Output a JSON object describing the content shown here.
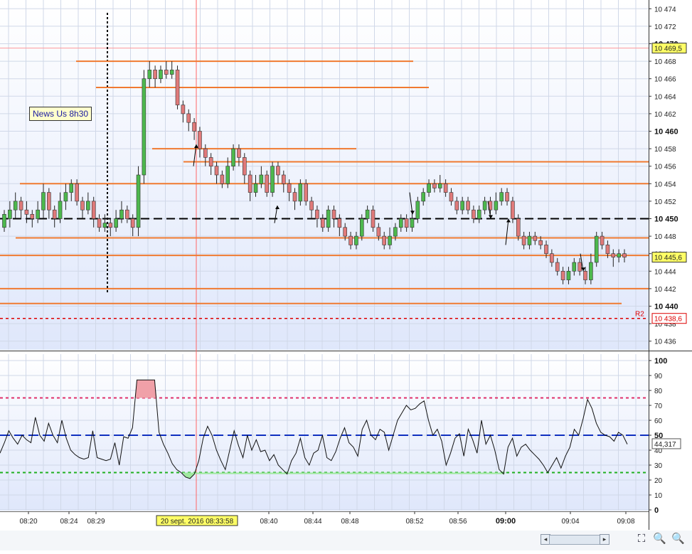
{
  "chart_data": [
    {
      "type": "candlestick",
      "title": "",
      "ylim": [
        10435,
        10475
      ],
      "y_ticks": [
        "10 436",
        "10 438",
        "10 440",
        "10 442",
        "10 444",
        "10 446",
        "10 448",
        "10 450",
        "10 452",
        "10 454",
        "10 456",
        "10 458",
        "10 460",
        "10 462",
        "10 464",
        "10 466",
        "10 468",
        "10 470",
        "10 472",
        "10 474"
      ],
      "x_ticks": [
        "08:20",
        "08:24",
        "08:29",
        "08:40",
        "08:44",
        "08:48",
        "08:52",
        "08:56",
        "09:00",
        "09:04",
        "09:08"
      ],
      "price_labels": [
        {
          "text": "10 469,5",
          "value": 10469.5,
          "color": "#ffff66"
        },
        {
          "text": "10 445,6",
          "value": 10445.6,
          "color": "#ffff66"
        },
        {
          "text": "10 438,6",
          "value": 10438.6,
          "color": "#ffffff"
        }
      ],
      "level_lines": [
        10468.0,
        10465.0,
        10458.0,
        10456.5,
        10454.0,
        10450.0,
        10447.8,
        10445.8,
        10442.0,
        10440.3,
        10438.6
      ],
      "r2_label": "R2",
      "annotation": "News Us 8h30",
      "crosshair_time_label": "20 sept. 2016 08:33:58",
      "candles": [
        [
          10449,
          10450.5,
          10448.5,
          10451
        ],
        [
          10450,
          10451,
          10449,
          10452
        ],
        [
          10451,
          10452,
          10450,
          10453
        ],
        [
          10452,
          10451,
          10450,
          10452.5
        ],
        [
          10451,
          10450.5,
          10449.5,
          10452
        ],
        [
          10450.5,
          10450,
          10449,
          10451
        ],
        [
          10450,
          10451,
          10449.5,
          10452
        ],
        [
          10451,
          10453,
          10450,
          10454
        ],
        [
          10453,
          10451,
          10450,
          10453.5
        ],
        [
          10451,
          10450,
          10449,
          10451.5
        ],
        [
          10450,
          10452,
          10449.5,
          10453
        ],
        [
          10452,
          10453,
          10451,
          10454
        ],
        [
          10453,
          10454,
          10452,
          10454.5
        ],
        [
          10454,
          10452,
          10451.5,
          10454.5
        ],
        [
          10452,
          10451,
          10450,
          10452.5
        ],
        [
          10451,
          10452,
          10450.5,
          10453
        ],
        [
          10452,
          10450,
          10449,
          10452.5
        ],
        [
          10450,
          10449,
          10448.5,
          10450.5
        ],
        [
          10449,
          10449.5,
          10448.5,
          10450.5
        ],
        [
          10449.5,
          10449,
          10448,
          10450
        ],
        [
          10449,
          10450,
          10448.5,
          10451
        ],
        [
          10450,
          10451,
          10449.5,
          10452
        ],
        [
          10451,
          10450,
          10449.5,
          10451.5
        ],
        [
          10450,
          10449,
          10448,
          10450.5
        ],
        [
          10449,
          10455,
          10448,
          10456
        ],
        [
          10455,
          10466,
          10454,
          10467
        ],
        [
          10466,
          10467,
          10465,
          10468
        ],
        [
          10467,
          10466,
          10465,
          10467.5
        ],
        [
          10466,
          10467,
          10465.5,
          10467.5
        ],
        [
          10467,
          10466.5,
          10466,
          10468
        ],
        [
          10466.5,
          10467,
          10466,
          10468
        ],
        [
          10467,
          10463,
          10462.5,
          10467.5
        ],
        [
          10463,
          10462,
          10461,
          10463.5
        ],
        [
          10462,
          10461,
          10460,
          10462.5
        ],
        [
          10461,
          10460,
          10459,
          10461.5
        ],
        [
          10460,
          10458,
          10457,
          10460.5
        ],
        [
          10458,
          10457,
          10456,
          10458.5
        ],
        [
          10457,
          10456,
          10455,
          10457.5
        ],
        [
          10456,
          10455,
          10454,
          10456.5
        ],
        [
          10455,
          10454,
          10453.5,
          10455.5
        ],
        [
          10454,
          10456,
          10453.5,
          10457
        ],
        [
          10456,
          10458,
          10455.5,
          10458.5
        ],
        [
          10458,
          10457,
          10456,
          10458.5
        ],
        [
          10457,
          10455,
          10454,
          10457.5
        ],
        [
          10455,
          10453,
          10452,
          10455.5
        ],
        [
          10453,
          10454,
          10452.5,
          10455
        ],
        [
          10454,
          10455,
          10453.5,
          10456
        ],
        [
          10455,
          10453,
          10452.5,
          10455.5
        ],
        [
          10453,
          10456,
          10452.5,
          10456.5
        ],
        [
          10456,
          10455,
          10454,
          10456.5
        ],
        [
          10455,
          10454,
          10453,
          10455.5
        ],
        [
          10454,
          10453,
          10452,
          10454.5
        ],
        [
          10453,
          10452,
          10451,
          10453.5
        ],
        [
          10452,
          10454,
          10451.5,
          10454.5
        ],
        [
          10454,
          10452,
          10451.5,
          10454.5
        ],
        [
          10452,
          10451,
          10450,
          10452.5
        ],
        [
          10451,
          10450,
          10449,
          10451.5
        ],
        [
          10450,
          10449,
          10448.5,
          10450.5
        ],
        [
          10449,
          10451,
          10448.5,
          10451.5
        ],
        [
          10451,
          10450,
          10449,
          10451.5
        ],
        [
          10450,
          10449,
          10448,
          10450.5
        ],
        [
          10449,
          10448,
          10447.5,
          10449.5
        ],
        [
          10448,
          10447,
          10446.5,
          10448.5
        ],
        [
          10447,
          10448,
          10446.5,
          10448.5
        ],
        [
          10448,
          10450,
          10447.5,
          10450.5
        ],
        [
          10450,
          10451,
          10449.5,
          10451.5
        ],
        [
          10451,
          10449,
          10448.5,
          10451.5
        ],
        [
          10449,
          10448,
          10447.5,
          10449.5
        ],
        [
          10448,
          10447,
          10446.5,
          10448.5
        ],
        [
          10447,
          10448,
          10446.5,
          10449
        ],
        [
          10448,
          10449,
          10447.5,
          10449.5
        ],
        [
          10449,
          10450,
          10448.5,
          10450.5
        ],
        [
          10450,
          10449,
          10448.5,
          10450.5
        ],
        [
          10449,
          10450,
          10448.5,
          10451
        ],
        [
          10450,
          10452,
          10449.5,
          10452.5
        ],
        [
          10452,
          10453,
          10451.5,
          10453.5
        ],
        [
          10453,
          10454,
          10452.5,
          10454.5
        ],
        [
          10454,
          10453.5,
          10453,
          10454.5
        ],
        [
          10453.5,
          10454,
          10453,
          10455
        ],
        [
          10454,
          10453,
          10452.5,
          10454.5
        ],
        [
          10453,
          10452,
          10451.5,
          10453.5
        ],
        [
          10452,
          10451,
          10450.5,
          10452.5
        ],
        [
          10451,
          10452,
          10450.5,
          10452.5
        ],
        [
          10452,
          10451,
          10450.5,
          10452.5
        ],
        [
          10451,
          10450,
          10449.5,
          10451.5
        ],
        [
          10450,
          10451,
          10449.5,
          10451.5
        ],
        [
          10451,
          10452,
          10450.5,
          10452.5
        ],
        [
          10452,
          10451,
          10450.5,
          10452.5
        ],
        [
          10451,
          10452,
          10450.5,
          10453
        ],
        [
          10452,
          10453,
          10451.5,
          10453.5
        ],
        [
          10453,
          10452,
          10451.5,
          10453.5
        ],
        [
          10452,
          10450,
          10449.5,
          10452.5
        ],
        [
          10450,
          10448,
          10447.5,
          10450.5
        ],
        [
          10448,
          10447,
          10446.5,
          10448.5
        ],
        [
          10447,
          10448,
          10446.5,
          10448.5
        ],
        [
          10448,
          10447.5,
          10447,
          10448.5
        ],
        [
          10447.5,
          10447,
          10446.5,
          10448
        ],
        [
          10447,
          10446,
          10445.5,
          10447.5
        ],
        [
          10446,
          10445,
          10444.5,
          10446.5
        ],
        [
          10445,
          10444,
          10443.5,
          10445.5
        ],
        [
          10444,
          10443,
          10442.5,
          10444.5
        ],
        [
          10443,
          10444,
          10442.5,
          10444.5
        ],
        [
          10444,
          10445,
          10443.5,
          10445.5
        ],
        [
          10445,
          10444,
          10443.5,
          10445.5
        ],
        [
          10444,
          10443,
          10442.5,
          10444.5
        ],
        [
          10443,
          10445,
          10442.5,
          10446
        ],
        [
          10445,
          10448,
          10444.5,
          10448.5
        ],
        [
          10448,
          10447,
          10446.5,
          10448.5
        ],
        [
          10447,
          10446,
          10445.5,
          10447.5
        ],
        [
          10446,
          10445.6,
          10444.5,
          10446.5
        ],
        [
          10445.6,
          10446,
          10445,
          10446.5
        ],
        [
          10446,
          10445.6,
          10445,
          10446.5
        ]
      ]
    },
    {
      "type": "line",
      "title": "",
      "ylim": [
        0,
        100
      ],
      "y_ticks": [
        "0",
        "10",
        "20",
        "30",
        "40",
        "50",
        "60",
        "70",
        "80",
        "90",
        "100"
      ],
      "levels": [
        75,
        50,
        25
      ],
      "current_value_label": "44,317",
      "values": [
        38,
        45,
        53,
        48,
        44,
        50,
        47,
        45,
        62,
        50,
        46,
        58,
        50,
        45,
        60,
        48,
        40,
        37,
        35,
        34,
        35,
        53,
        35,
        34,
        33,
        34,
        45,
        30,
        49,
        48,
        55,
        87,
        87,
        87,
        87,
        87,
        52,
        44,
        38,
        31,
        27,
        25,
        22,
        21,
        24,
        33,
        48,
        56,
        50,
        40,
        33,
        27,
        40,
        53,
        43,
        35,
        50,
        40,
        47,
        39,
        40,
        33,
        37,
        30,
        27,
        24,
        33,
        38,
        48,
        35,
        30,
        38,
        40,
        50,
        35,
        33,
        39,
        48,
        55,
        45,
        42,
        36,
        54,
        60,
        50,
        47,
        54,
        52,
        40,
        50,
        60,
        65,
        70,
        67,
        68,
        71,
        73,
        60,
        50,
        54,
        46,
        30,
        38,
        48,
        51,
        36,
        54,
        47,
        38,
        60,
        44,
        50,
        40,
        27,
        24,
        42,
        48,
        36,
        42,
        44,
        40,
        37,
        34,
        30,
        25,
        30,
        35,
        28,
        36,
        42,
        54,
        50,
        61,
        74,
        68,
        58,
        52,
        50,
        49,
        46,
        52,
        50,
        44
      ]
    }
  ],
  "toolbar": {
    "scroll_left": "◂",
    "scroll_right": "▸",
    "fit_icon": "⛶",
    "zoom_out_icon": "🔍",
    "zoom_in_icon": "🔍"
  }
}
